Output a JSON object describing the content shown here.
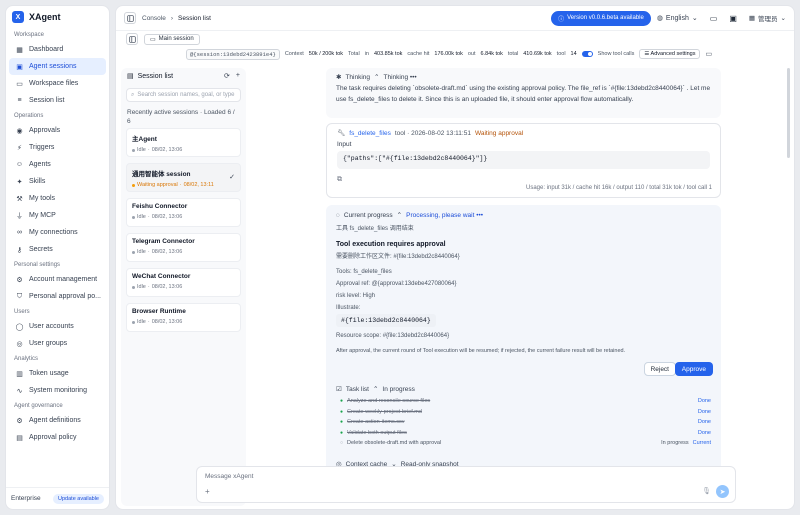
{
  "app": {
    "name": "XAgent",
    "logo": "X"
  },
  "nav": {
    "sections": [
      {
        "title": "Workspace",
        "items": [
          "Dashboard",
          "Agent sessions",
          "Workspace files",
          "Session list"
        ]
      },
      {
        "title": "Operations",
        "items": [
          "Approvals",
          "Triggers",
          "Agents",
          "Skills",
          "My tools",
          "My MCP",
          "My connections",
          "Secrets"
        ]
      },
      {
        "title": "Personal settings",
        "items": [
          "Account management",
          "Personal approval po..."
        ]
      },
      {
        "title": "Users",
        "items": [
          "User accounts",
          "User groups"
        ]
      },
      {
        "title": "Analytics",
        "items": [
          "Token usage",
          "System monitoring"
        ]
      },
      {
        "title": "Agent governance",
        "items": [
          "Agent definitions",
          "Approval policy"
        ]
      }
    ],
    "active": "Agent sessions",
    "footer": {
      "label": "Enterprise",
      "badge": "Update available"
    }
  },
  "topbar": {
    "breadcrumb": [
      "Console",
      "Session list"
    ],
    "version": "Version v0.0.6.beta available",
    "language": "English",
    "user": "管理员"
  },
  "session_bar": {
    "main_session": "Main session"
  },
  "stats": {
    "session_id": "@{session:13debd2423891e4}",
    "context_label": "Context",
    "context_value": "50k / 200k tok",
    "total_in_label": "Total",
    "total_in_sub": "in",
    "total_in_value": "403.85k tok",
    "cache_label": "cache hit",
    "cache_value": "176.00k tok",
    "out_label": "out",
    "out_value": "6.84k tok",
    "total_label": "total",
    "total_value": "410.69k tok",
    "tool_label": "tool",
    "tool_value": "14",
    "show_tool_calls": "Show tool calls",
    "advanced": "Advanced settings"
  },
  "session_list": {
    "title": "Session list",
    "search_placeholder": "Search session names, goal, or type",
    "recent": "Recently active sessions · Loaded 6 / 6",
    "sessions": [
      {
        "name": "主Agent",
        "status": "Idle",
        "time": "08/02, 13:06"
      },
      {
        "name": "通用智能体 session",
        "status": "Waiting approval",
        "time": "08/02, 13:11"
      },
      {
        "name": "Feishu Connector",
        "status": "Idle",
        "time": "08/02, 13:06"
      },
      {
        "name": "Telegram Connector",
        "status": "Idle",
        "time": "08/02, 13:06"
      },
      {
        "name": "WeChat Connector",
        "status": "Idle",
        "time": "08/02, 13:06"
      },
      {
        "name": "Browser Runtime",
        "status": "Idle",
        "time": "08/02, 13:06"
      }
    ]
  },
  "conversation": {
    "thinking": "Thinking",
    "thinking_dots": "Thinking •••",
    "message": "The task requires deleting `obsolete-draft.md` using the existing approval policy. The file_ref is `#{file:13debd2c8440064}` . Let me use fs_delete_files to delete it. Since this is an uploaded file, it should enter approval flow automatically.",
    "tool_call": {
      "name": "fs_delete_files",
      "meta": "tool · 2026-08-02 13:11:51",
      "status": "Waiting approval",
      "input_label": "Input",
      "input": "{\"paths\":[\"#{file:13debd2c8440064}\"]}",
      "usage": "Usage: input 31k / cache hit 16k / output 110 / total 31k tok / tool call 1"
    },
    "progress": {
      "title": "Current progress",
      "state": "Processing, please wait •••",
      "sub": "工具 fs_delete_files 调用结束",
      "approval_title": "Tool execution requires approval",
      "approval_desc": "需要删除工作区文件: #{file:13debd2c8440064}",
      "tools": "Tools:  fs_delete_files",
      "approval_ref": "Approval ref:  @{approval:13debe427080064}",
      "risk": "risk level:  High",
      "illustrate_label": "Illustrate:",
      "illustrate": "#{file:13debd2c8440064}",
      "scope": "Resource scope:  #{file:13debd2c8440064}",
      "note": "After approval, the current round of Tool execution will be resumed; if rejected, the current failure result will be retained.",
      "reject": "Reject",
      "approve": "Approve"
    },
    "task_list": {
      "title": "Task list",
      "state": "In progress",
      "tasks": [
        {
          "name": "Analyze and reconcile source files",
          "state": "",
          "status": "Done",
          "done": true
        },
        {
          "name": "Create weekly-project-brief.md",
          "state": "",
          "status": "Done",
          "done": true
        },
        {
          "name": "Create action-items.csv",
          "state": "",
          "status": "Done",
          "done": true
        },
        {
          "name": "Validate both output files",
          "state": "",
          "status": "Done",
          "done": true
        },
        {
          "name": "Delete obsolete-draft.md with approval",
          "state": "In progress",
          "status": "Current",
          "done": false
        }
      ]
    },
    "context_cache": {
      "title": "Context cache",
      "state": "Read-only snapshot"
    }
  },
  "composer": {
    "placeholder": "Message xAgent"
  }
}
